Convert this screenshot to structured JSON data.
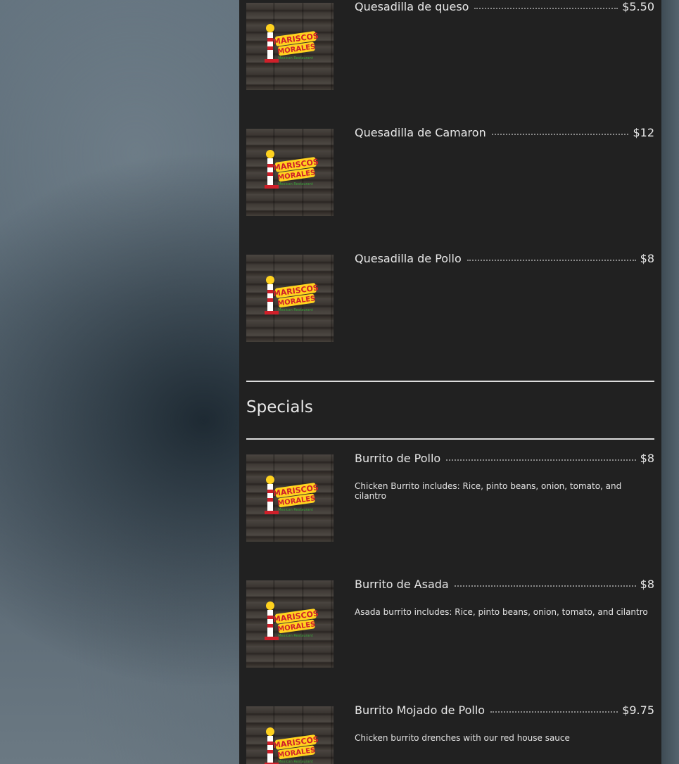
{
  "menu": {
    "items_top": [
      {
        "name": "Quesadilla de queso",
        "price": "$5.50",
        "description": ""
      },
      {
        "name": "Quesadilla de Camaron",
        "price": "$12",
        "description": ""
      },
      {
        "name": "Quesadilla de Pollo",
        "price": "$8",
        "description": ""
      }
    ],
    "specials": {
      "title": "Specials",
      "items": [
        {
          "name": "Burrito de Pollo",
          "price": "$8",
          "description": "Chicken Burrito includes: Rice, pinto beans, onion, tomato, and cilantro"
        },
        {
          "name": "Burrito de Asada",
          "price": "$8",
          "description": "Asada burrito includes: Rice, pinto beans, onion, tomato, and cilantro"
        },
        {
          "name": "Burrito Mojado de Pollo",
          "price": "$9.75",
          "description": "Chicken burrito drenches with our red house sauce"
        }
      ]
    },
    "logo": {
      "line1": "MARISCOS",
      "line2": "MORALES",
      "line3": "Mexican Restaurant"
    }
  },
  "colors": {
    "panel_bg": "#212121",
    "text": "#e8e8e8",
    "logo_red": "#d0202a",
    "logo_yellow": "#ffd21f",
    "logo_green": "#3aa53a"
  }
}
